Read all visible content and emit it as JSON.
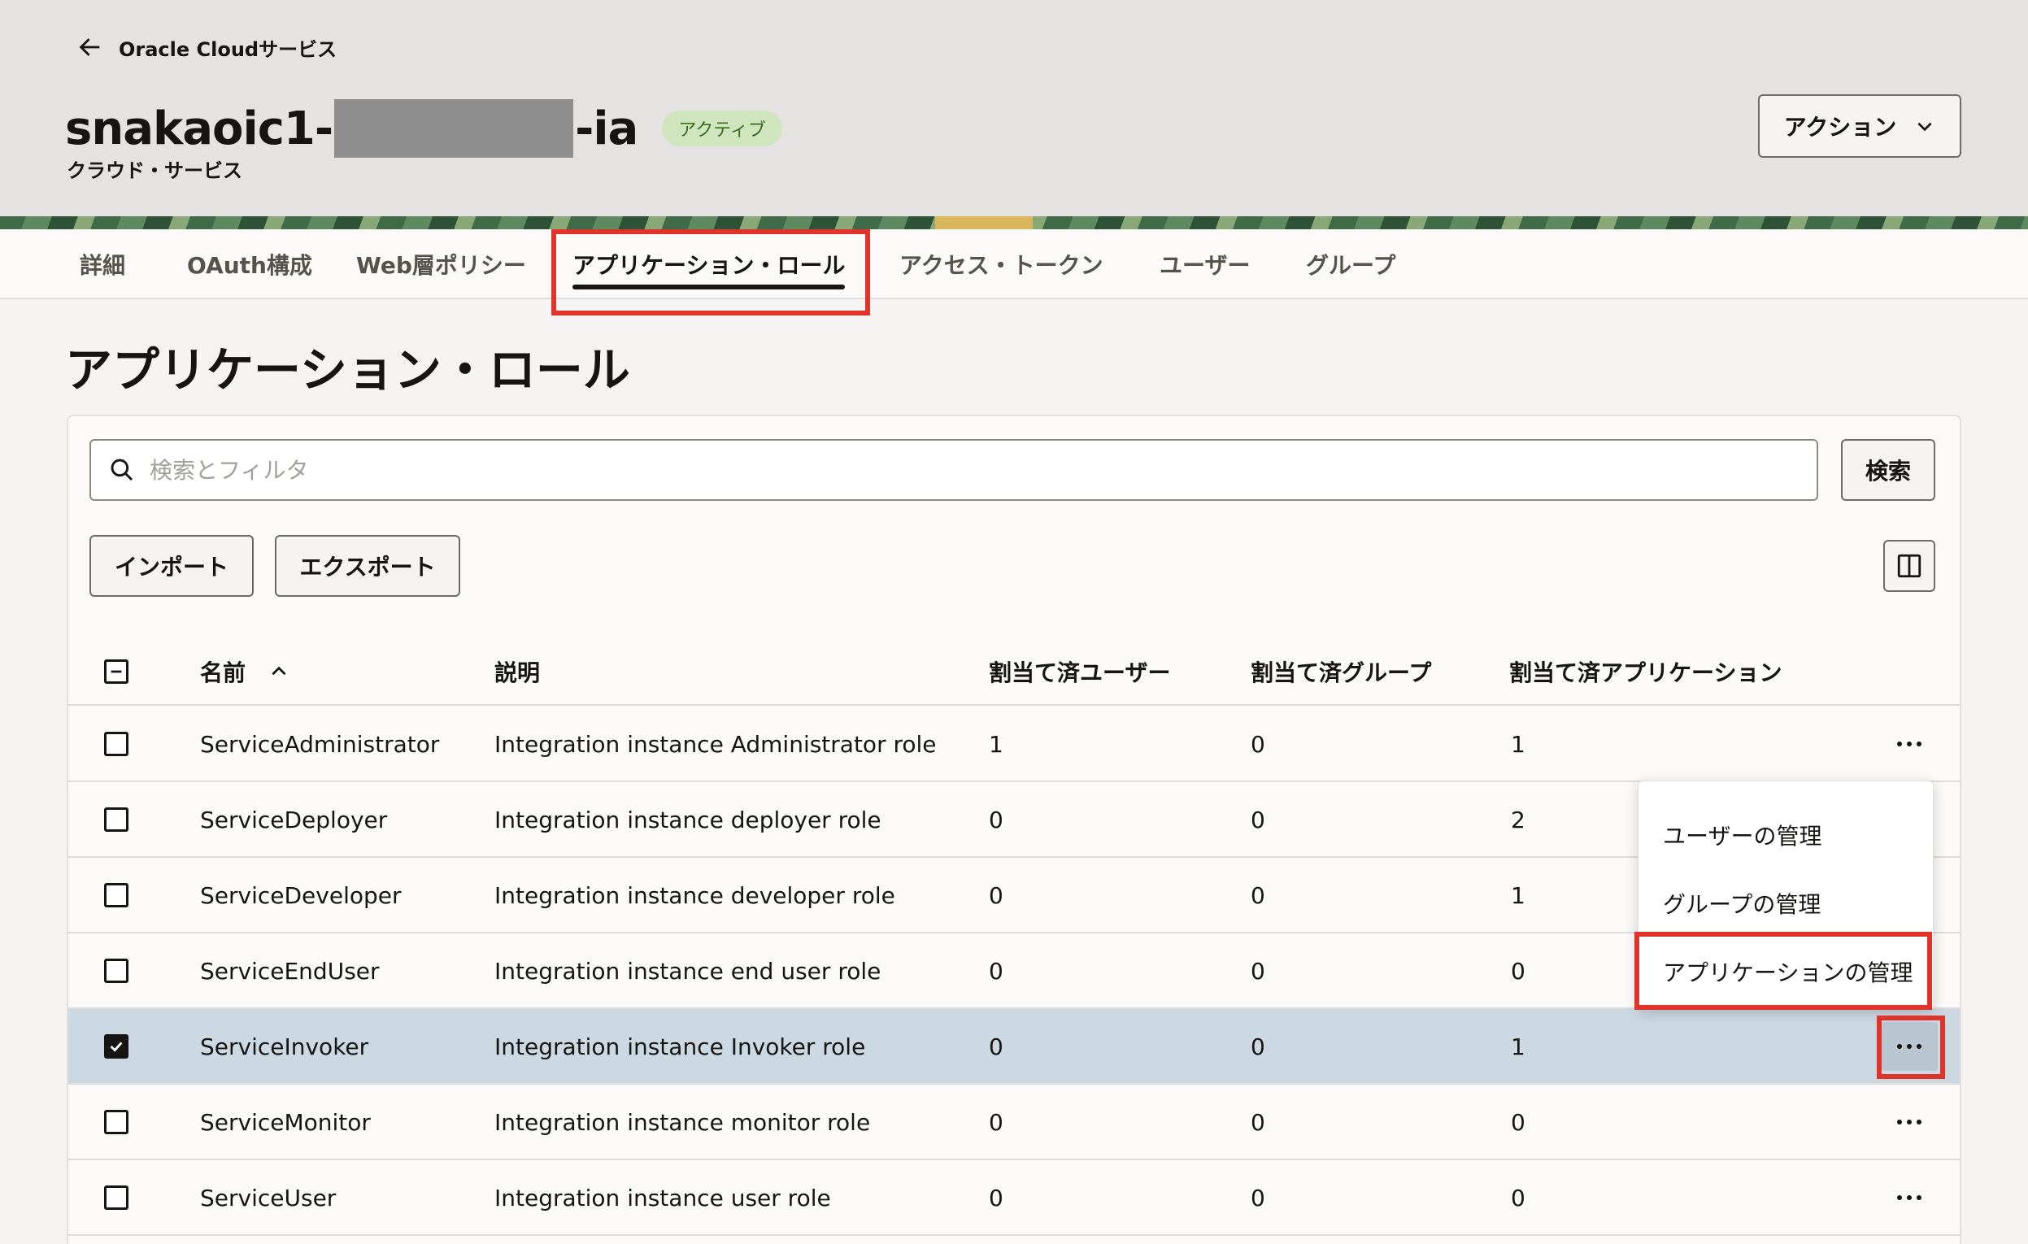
{
  "header": {
    "back_link": "Oracle Cloudサービス",
    "title_prefix": "snakaoic1-",
    "title_suffix": "-ia",
    "status": "アクティブ",
    "subtitle": "クラウド・サービス",
    "action_label": "アクション"
  },
  "tabs": [
    {
      "label": "詳細"
    },
    {
      "label": "OAuth構成"
    },
    {
      "label": "Web層ポリシー"
    },
    {
      "label": "アプリケーション・ロール"
    },
    {
      "label": "アクセス・トークン"
    },
    {
      "label": "ユーザー"
    },
    {
      "label": "グループ"
    }
  ],
  "page_title": "アプリケーション・ロール",
  "search": {
    "placeholder": "検索とフィルタ",
    "value": "",
    "button_label": "検索"
  },
  "toolbar": {
    "import_label": "インポート",
    "export_label": "エクスポート"
  },
  "table": {
    "columns": {
      "name": "名前",
      "description": "説明",
      "assigned_users": "割当て済ユーザー",
      "assigned_groups": "割当て済グループ",
      "assigned_apps": "割当て済アプリケーション"
    },
    "rows": [
      {
        "name": "ServiceAdministrator",
        "description": "Integration instance Administrator role",
        "users": "1",
        "groups": "0",
        "apps": "1",
        "checked": false
      },
      {
        "name": "ServiceDeployer",
        "description": "Integration instance deployer role",
        "users": "0",
        "groups": "0",
        "apps": "2",
        "checked": false
      },
      {
        "name": "ServiceDeveloper",
        "description": "Integration instance developer role",
        "users": "0",
        "groups": "0",
        "apps": "1",
        "checked": false
      },
      {
        "name": "ServiceEndUser",
        "description": "Integration instance end user role",
        "users": "0",
        "groups": "0",
        "apps": "0",
        "checked": false
      },
      {
        "name": "ServiceInvoker",
        "description": "Integration instance Invoker role",
        "users": "0",
        "groups": "0",
        "apps": "1",
        "checked": true
      },
      {
        "name": "ServiceMonitor",
        "description": "Integration instance monitor role",
        "users": "0",
        "groups": "0",
        "apps": "0",
        "checked": false
      },
      {
        "name": "ServiceUser",
        "description": "Integration instance user role",
        "users": "0",
        "groups": "0",
        "apps": "0",
        "checked": false
      }
    ]
  },
  "context_menu": {
    "items": [
      {
        "label": "ユーザーの管理"
      },
      {
        "label": "グループの管理"
      },
      {
        "label": "アプリケーションの管理"
      }
    ]
  },
  "colors": {
    "highlight": "#e0342a",
    "selected_row": "#ccd8e2",
    "status_badge": "#cfe5bd"
  },
  "icons": {
    "back": "arrow-left-icon",
    "search": "search-icon",
    "chevron": "chevron-down-icon",
    "sort": "chevron-up-icon",
    "columns": "column-layout-icon",
    "more": "ellipsis-icon"
  }
}
